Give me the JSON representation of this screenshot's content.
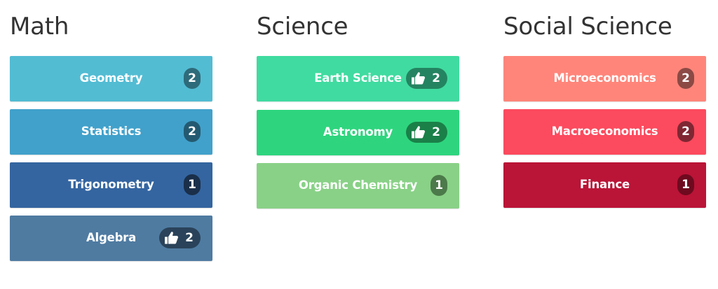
{
  "columns": [
    {
      "heading": "Math",
      "items": [
        {
          "label": "Geometry",
          "count": "2",
          "liked": false,
          "color": "#52bcd3",
          "badge_color": "#2e6b7a"
        },
        {
          "label": "Statistics",
          "count": "2",
          "liked": false,
          "color": "#41a1cb",
          "badge_color": "#245a71"
        },
        {
          "label": "Trigonometry",
          "count": "1",
          "liked": false,
          "color": "#3465a0",
          "badge_color": "#1a2f4a"
        },
        {
          "label": "Algebra",
          "count": "2",
          "liked": true,
          "color": "#4f7ba1",
          "badge_color": "#2a435a"
        }
      ]
    },
    {
      "heading": "Science",
      "items": [
        {
          "label": "Earth Science",
          "count": "2",
          "liked": true,
          "color": "#40dba0",
          "badge_color": "#248461"
        },
        {
          "label": "Astronomy",
          "count": "2",
          "liked": true,
          "color": "#2ed57e",
          "badge_color": "#1a8048"
        },
        {
          "label": "Organic Chemistry",
          "count": "1",
          "liked": false,
          "color": "#89d187",
          "badge_color": "#4c7a4a"
        }
      ]
    },
    {
      "heading": "Social Science",
      "items": [
        {
          "label": "Microeconomics",
          "count": "2",
          "liked": false,
          "color": "#ff857a",
          "badge_color": "#8c4a45"
        },
        {
          "label": "Macroeconomics",
          "count": "2",
          "liked": false,
          "color": "#fc4a5e",
          "badge_color": "#7f2733"
        },
        {
          "label": "Finance",
          "count": "1",
          "liked": false,
          "color": "#ba1437",
          "badge_color": "#6e0a1f"
        }
      ]
    }
  ],
  "icons": {
    "like": "thumbs-up-icon"
  }
}
